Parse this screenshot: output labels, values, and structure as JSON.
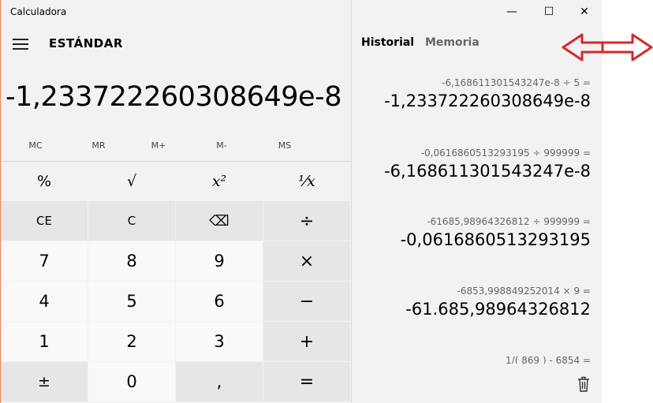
{
  "window": {
    "title": "Calculadora",
    "minimize": "—",
    "maximize": "☐",
    "close": "✕"
  },
  "header": {
    "mode": "ESTÁNDAR"
  },
  "display": {
    "value": "-1,233722260308649e-8"
  },
  "memory": [
    "MC",
    "MR",
    "M+",
    "M-",
    "MS"
  ],
  "keys": {
    "row0": [
      "%",
      "√",
      "x²",
      "¹⁄x"
    ],
    "row1": [
      "CE",
      "C",
      "⌫",
      "÷"
    ],
    "row2": [
      "7",
      "8",
      "9",
      "×"
    ],
    "row3": [
      "4",
      "5",
      "6",
      "−"
    ],
    "row4": [
      "1",
      "2",
      "3",
      "+"
    ],
    "row5": [
      "±",
      "0",
      ",",
      "="
    ]
  },
  "tabs": {
    "history": "Historial",
    "memory": "Memoria"
  },
  "history": [
    {
      "expr": "-6,168611301543247e-8   ÷   5 =",
      "result": "-1,233722260308649e-8"
    },
    {
      "expr": "-0,0616860513293195   ÷   999999 =",
      "result": "-6,168611301543247e-8"
    },
    {
      "expr": "-61685,98964326812   ÷   999999 =",
      "result": "-0,0616860513293195"
    },
    {
      "expr": "-6853,998849252014   ×   9 =",
      "result": "-61.685,98964326812"
    },
    {
      "expr": "1/( 869 )  -  6854 =",
      "result": ""
    }
  ],
  "colors": {
    "annotation_arrow": "#d9262c",
    "window_bg": "#f2f2f2",
    "accent_border": "#e7825a"
  },
  "icons": {
    "hamburger": "hamburger-icon",
    "trash": "trash-icon",
    "arrow": "double-arrow-icon"
  }
}
